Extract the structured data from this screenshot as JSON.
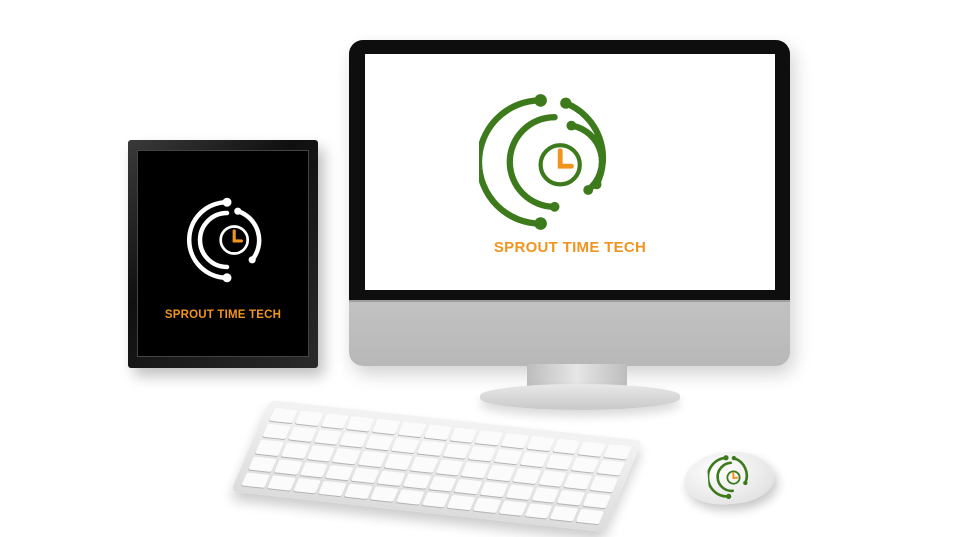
{
  "brand": {
    "name": "SPROUT TIME TECH"
  },
  "colors": {
    "green": "#3d7a1c",
    "orange": "#f0941e",
    "white": "#ffffff",
    "black": "#000000"
  },
  "objects": {
    "frame": {
      "icon": "sprout-clock-logo-white"
    },
    "monitor": {
      "icon": "sprout-clock-logo-green"
    },
    "mouse": {
      "icon": "sprout-clock-logo-green"
    },
    "keyboard": {
      "rows": 5
    }
  }
}
